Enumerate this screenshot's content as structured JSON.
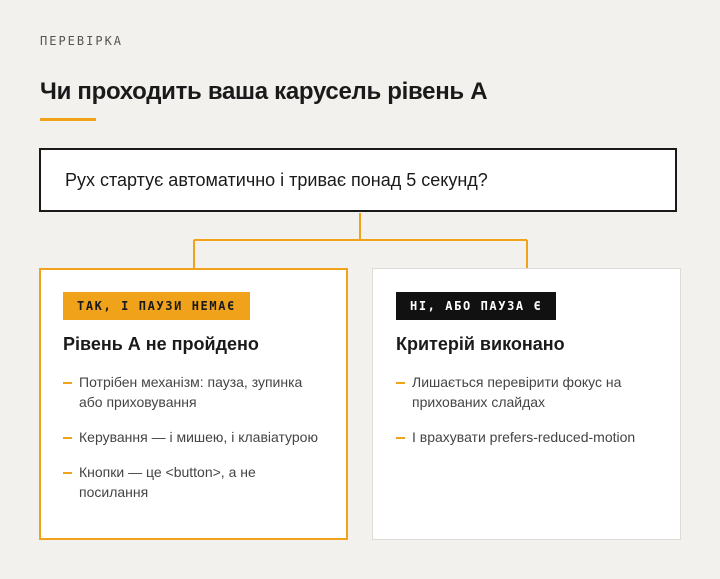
{
  "eyebrow": "ПЕРЕВІРКА",
  "title": "Чи проходить ваша карусель рівень А",
  "question": "Рух стартує автоматично і триває понад 5 секунд?",
  "colors": {
    "accent": "#f0a21b",
    "dark": "#111111",
    "background": "#f3f1ee"
  },
  "branches": {
    "yes": {
      "badge": "ТАК, І ПАУЗИ НЕМАЄ",
      "heading": "Рівень А не пройдено",
      "items": [
        "Потрібен механізм: пауза, зупинка або приховування",
        "Керування — і мишею, і клавіатурою",
        "Кнопки — це <button>, а не посилання"
      ]
    },
    "no": {
      "badge": "НІ, АБО ПАУЗА Є",
      "heading": "Критерій виконано",
      "items": [
        "Лишається перевірити фокус на прихованих слайдах",
        "І врахувати prefers-reduced-motion"
      ]
    }
  }
}
